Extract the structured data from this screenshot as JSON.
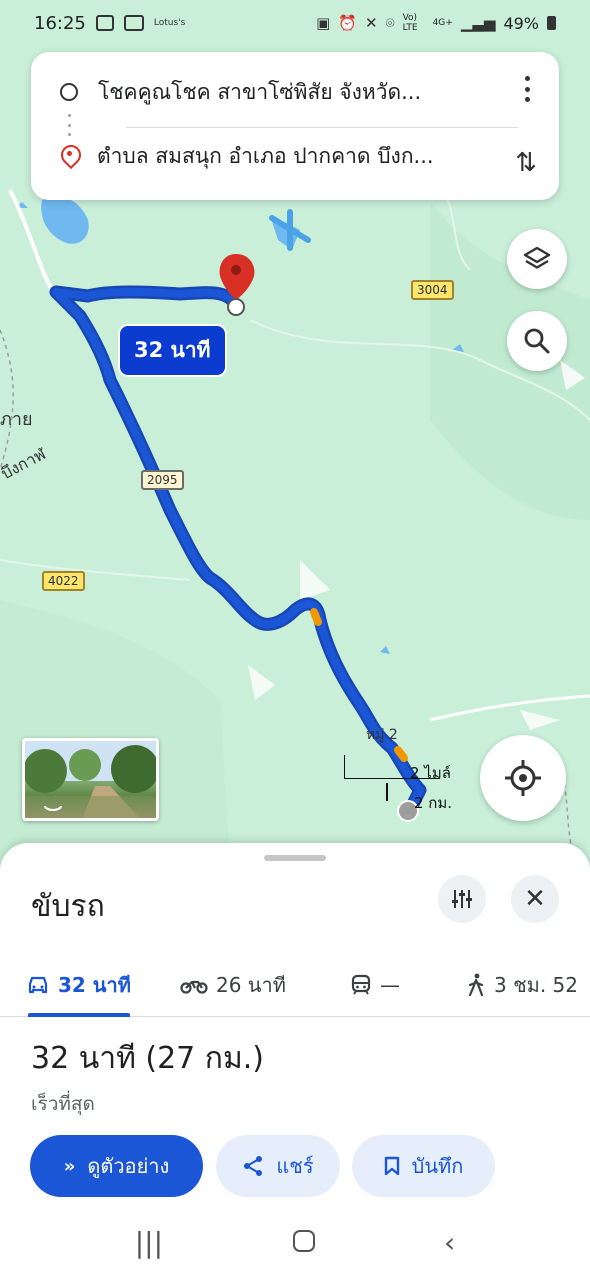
{
  "status_bar": {
    "time": "16:25",
    "notif_lotus": "Lotus's",
    "net_volte": "Vo) LTE",
    "net_4g": "4G+",
    "battery": "49%"
  },
  "search": {
    "origin": "โชคคูณโชค สาขาโซ่พิสัย จังหวัด...",
    "destination": "ตำบล สมสนุก อำเภอ ปากคาด บึงก..."
  },
  "map": {
    "duration_bubble": "32 นาที",
    "roads": [
      "3004",
      "2095",
      "4022"
    ],
    "place_labels": [
      "หมู่ 2",
      "ภาย",
      "บึงกาฬ"
    ],
    "scale_top": "2 ไมล์",
    "scale_bottom": "2 กม.",
    "colors": {
      "route": "#1a56d6",
      "traffic": "#f29900",
      "water": "#6fb8f0",
      "land": "#c9efd8"
    }
  },
  "sheet": {
    "mode_title": "ขับรถ",
    "tabs": [
      {
        "icon": "car-icon",
        "label": "32 นาที"
      },
      {
        "icon": "motorcycle-icon",
        "label": "26 นาที"
      },
      {
        "icon": "transit-icon",
        "label": "—"
      },
      {
        "icon": "walk-icon",
        "label": "3 ชม. 52"
      }
    ],
    "route_time": "32 นาที (27 กม.)",
    "route_note": "เร็วที่สุด",
    "buttons": {
      "preview": "ดูตัวอย่าง",
      "share": "แชร์",
      "save": "บันทึก"
    }
  }
}
